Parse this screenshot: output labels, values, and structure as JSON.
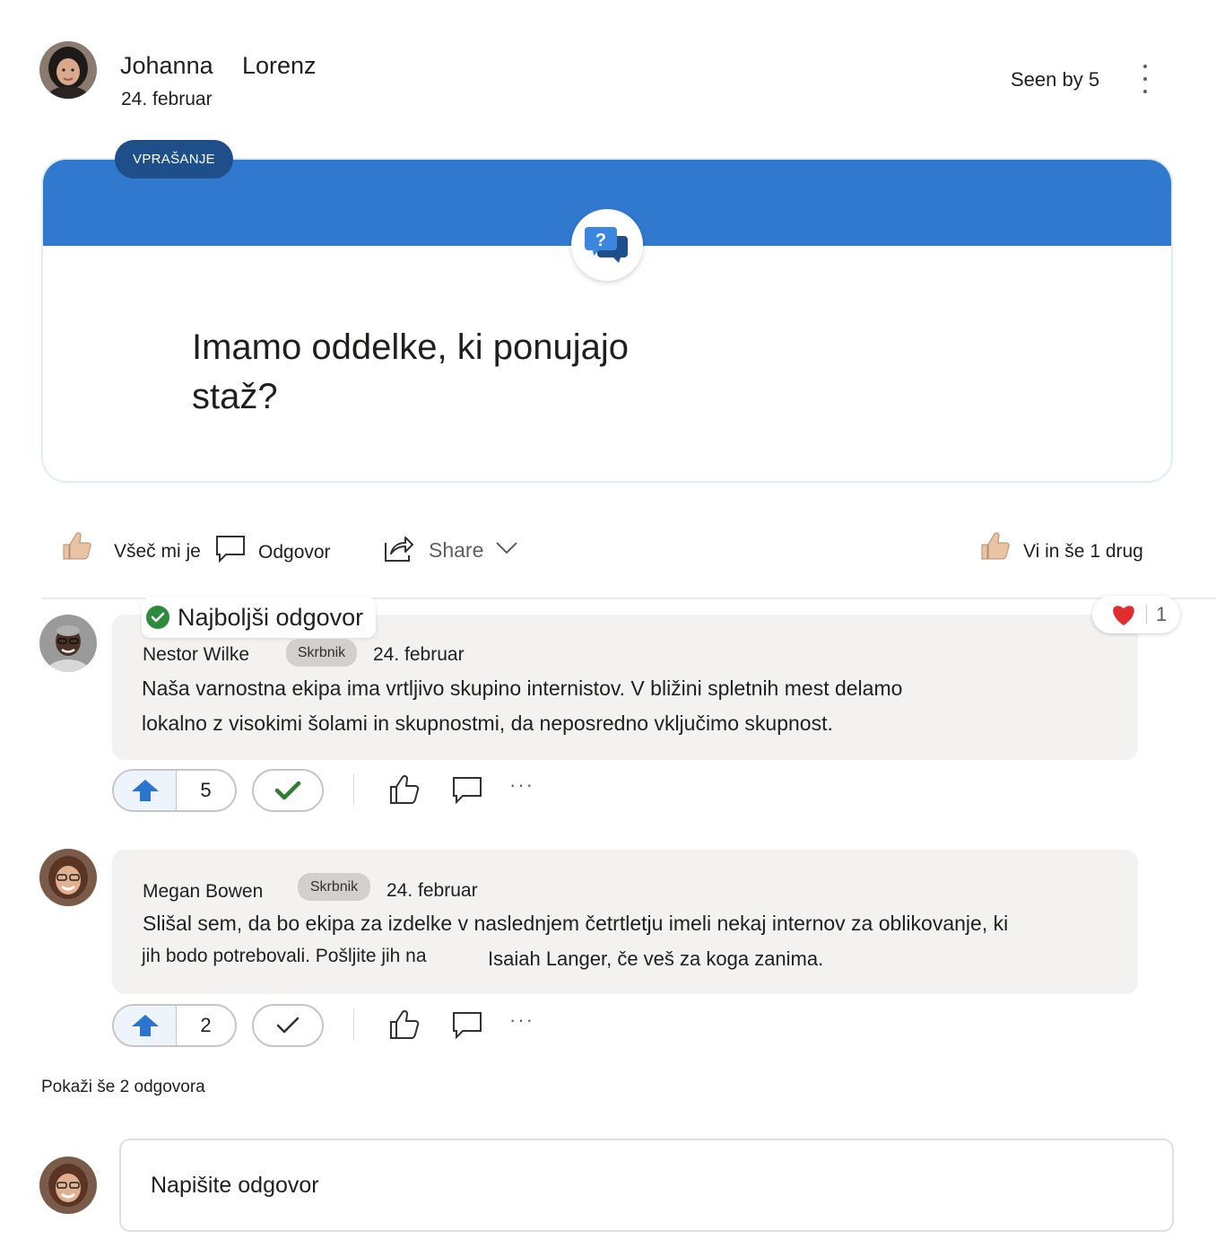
{
  "post": {
    "author_first": "Johanna",
    "author_last": "Lorenz",
    "date": "24. februar",
    "seen_by": "Seen by 5",
    "badge": "VPRAŠANJE",
    "question_line1": "Imamo oddelke, ki ponujajo",
    "question_line2": "staž?"
  },
  "actions": {
    "like": "Všeč mi je",
    "reply": "Odgovor",
    "share": "Share",
    "likes_summary": "Vi in še 1 drug"
  },
  "best_answer_label": "Najboljši odgovor",
  "replies": [
    {
      "name": "Nestor Wilke",
      "role": "Skrbnik",
      "date": "24. februar",
      "line1": "Naša varnostna ekipa ima vrtljivo skupino internistov. V bližini spletnih mest delamo",
      "line2": "lokalno z visokimi šolami in skupnostmi, da neposredno vključimo skupnost.",
      "votes": "5",
      "heart_count": "1",
      "accepted": true
    },
    {
      "name": "Megan Bowen",
      "role": "Skrbnik",
      "date": "24. februar",
      "line1": "Slišal sem, da bo ekipa za izdelke v naslednjem četrtletju imeli nekaj internov za oblikovanje, ki",
      "line2a": "jih bodo potrebovali. Pošljite jih na",
      "line2b": "Isaiah Langer, če veš za koga zanima.",
      "votes": "2",
      "accepted": false
    }
  ],
  "show_more": "Pokaži še 2 odgovora",
  "composer": {
    "placeholder": "Napišite odgovor"
  },
  "colors": {
    "accent_blue": "#3178cf",
    "badge_navy": "#1f4f8b",
    "accept_green": "#2e7d32",
    "heart_red": "#e02e2e"
  },
  "icons": [
    "question-chat-icon",
    "thumbs-up-icon",
    "comment-icon",
    "share-icon",
    "chevron-down-icon",
    "more-vertical-icon",
    "check-circle-icon",
    "heart-icon",
    "upvote-arrow-icon",
    "checkmark-icon",
    "ellipsis-icon"
  ]
}
